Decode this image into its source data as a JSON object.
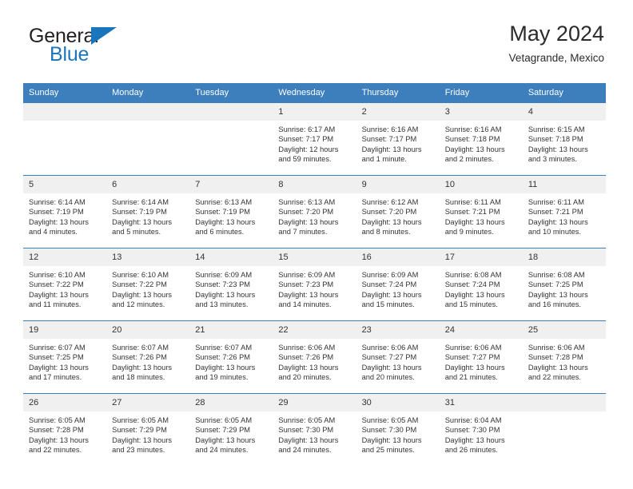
{
  "brand": {
    "name_top": "General",
    "name_bottom": "Blue",
    "accent_color": "#1b75bb",
    "triangle_icon": "triangle-logo-icon"
  },
  "header": {
    "title": "May 2024",
    "subtitle": "Vetagrande, Mexico"
  },
  "calendar": {
    "header_bg": "#3d7ebd",
    "daynum_bg": "#f0f0f0",
    "weekday_headers": [
      "Sunday",
      "Monday",
      "Tuesday",
      "Wednesday",
      "Thursday",
      "Friday",
      "Saturday"
    ],
    "weeks": [
      [
        {
          "day": "",
          "empty": true
        },
        {
          "day": "",
          "empty": true
        },
        {
          "day": "",
          "empty": true
        },
        {
          "day": "1",
          "sunrise": "Sunrise: 6:17 AM",
          "sunset": "Sunset: 7:17 PM",
          "daylight": "Daylight: 12 hours and 59 minutes."
        },
        {
          "day": "2",
          "sunrise": "Sunrise: 6:16 AM",
          "sunset": "Sunset: 7:17 PM",
          "daylight": "Daylight: 13 hours and 1 minute."
        },
        {
          "day": "3",
          "sunrise": "Sunrise: 6:16 AM",
          "sunset": "Sunset: 7:18 PM",
          "daylight": "Daylight: 13 hours and 2 minutes."
        },
        {
          "day": "4",
          "sunrise": "Sunrise: 6:15 AM",
          "sunset": "Sunset: 7:18 PM",
          "daylight": "Daylight: 13 hours and 3 minutes."
        }
      ],
      [
        {
          "day": "5",
          "sunrise": "Sunrise: 6:14 AM",
          "sunset": "Sunset: 7:19 PM",
          "daylight": "Daylight: 13 hours and 4 minutes."
        },
        {
          "day": "6",
          "sunrise": "Sunrise: 6:14 AM",
          "sunset": "Sunset: 7:19 PM",
          "daylight": "Daylight: 13 hours and 5 minutes."
        },
        {
          "day": "7",
          "sunrise": "Sunrise: 6:13 AM",
          "sunset": "Sunset: 7:19 PM",
          "daylight": "Daylight: 13 hours and 6 minutes."
        },
        {
          "day": "8",
          "sunrise": "Sunrise: 6:13 AM",
          "sunset": "Sunset: 7:20 PM",
          "daylight": "Daylight: 13 hours and 7 minutes."
        },
        {
          "day": "9",
          "sunrise": "Sunrise: 6:12 AM",
          "sunset": "Sunset: 7:20 PM",
          "daylight": "Daylight: 13 hours and 8 minutes."
        },
        {
          "day": "10",
          "sunrise": "Sunrise: 6:11 AM",
          "sunset": "Sunset: 7:21 PM",
          "daylight": "Daylight: 13 hours and 9 minutes."
        },
        {
          "day": "11",
          "sunrise": "Sunrise: 6:11 AM",
          "sunset": "Sunset: 7:21 PM",
          "daylight": "Daylight: 13 hours and 10 minutes."
        }
      ],
      [
        {
          "day": "12",
          "sunrise": "Sunrise: 6:10 AM",
          "sunset": "Sunset: 7:22 PM",
          "daylight": "Daylight: 13 hours and 11 minutes."
        },
        {
          "day": "13",
          "sunrise": "Sunrise: 6:10 AM",
          "sunset": "Sunset: 7:22 PM",
          "daylight": "Daylight: 13 hours and 12 minutes."
        },
        {
          "day": "14",
          "sunrise": "Sunrise: 6:09 AM",
          "sunset": "Sunset: 7:23 PM",
          "daylight": "Daylight: 13 hours and 13 minutes."
        },
        {
          "day": "15",
          "sunrise": "Sunrise: 6:09 AM",
          "sunset": "Sunset: 7:23 PM",
          "daylight": "Daylight: 13 hours and 14 minutes."
        },
        {
          "day": "16",
          "sunrise": "Sunrise: 6:09 AM",
          "sunset": "Sunset: 7:24 PM",
          "daylight": "Daylight: 13 hours and 15 minutes."
        },
        {
          "day": "17",
          "sunrise": "Sunrise: 6:08 AM",
          "sunset": "Sunset: 7:24 PM",
          "daylight": "Daylight: 13 hours and 15 minutes."
        },
        {
          "day": "18",
          "sunrise": "Sunrise: 6:08 AM",
          "sunset": "Sunset: 7:25 PM",
          "daylight": "Daylight: 13 hours and 16 minutes."
        }
      ],
      [
        {
          "day": "19",
          "sunrise": "Sunrise: 6:07 AM",
          "sunset": "Sunset: 7:25 PM",
          "daylight": "Daylight: 13 hours and 17 minutes."
        },
        {
          "day": "20",
          "sunrise": "Sunrise: 6:07 AM",
          "sunset": "Sunset: 7:26 PM",
          "daylight": "Daylight: 13 hours and 18 minutes."
        },
        {
          "day": "21",
          "sunrise": "Sunrise: 6:07 AM",
          "sunset": "Sunset: 7:26 PM",
          "daylight": "Daylight: 13 hours and 19 minutes."
        },
        {
          "day": "22",
          "sunrise": "Sunrise: 6:06 AM",
          "sunset": "Sunset: 7:26 PM",
          "daylight": "Daylight: 13 hours and 20 minutes."
        },
        {
          "day": "23",
          "sunrise": "Sunrise: 6:06 AM",
          "sunset": "Sunset: 7:27 PM",
          "daylight": "Daylight: 13 hours and 20 minutes."
        },
        {
          "day": "24",
          "sunrise": "Sunrise: 6:06 AM",
          "sunset": "Sunset: 7:27 PM",
          "daylight": "Daylight: 13 hours and 21 minutes."
        },
        {
          "day": "25",
          "sunrise": "Sunrise: 6:06 AM",
          "sunset": "Sunset: 7:28 PM",
          "daylight": "Daylight: 13 hours and 22 minutes."
        }
      ],
      [
        {
          "day": "26",
          "sunrise": "Sunrise: 6:05 AM",
          "sunset": "Sunset: 7:28 PM",
          "daylight": "Daylight: 13 hours and 22 minutes."
        },
        {
          "day": "27",
          "sunrise": "Sunrise: 6:05 AM",
          "sunset": "Sunset: 7:29 PM",
          "daylight": "Daylight: 13 hours and 23 minutes."
        },
        {
          "day": "28",
          "sunrise": "Sunrise: 6:05 AM",
          "sunset": "Sunset: 7:29 PM",
          "daylight": "Daylight: 13 hours and 24 minutes."
        },
        {
          "day": "29",
          "sunrise": "Sunrise: 6:05 AM",
          "sunset": "Sunset: 7:30 PM",
          "daylight": "Daylight: 13 hours and 24 minutes."
        },
        {
          "day": "30",
          "sunrise": "Sunrise: 6:05 AM",
          "sunset": "Sunset: 7:30 PM",
          "daylight": "Daylight: 13 hours and 25 minutes."
        },
        {
          "day": "31",
          "sunrise": "Sunrise: 6:04 AM",
          "sunset": "Sunset: 7:30 PM",
          "daylight": "Daylight: 13 hours and 26 minutes."
        },
        {
          "day": "",
          "empty": true
        }
      ]
    ]
  }
}
